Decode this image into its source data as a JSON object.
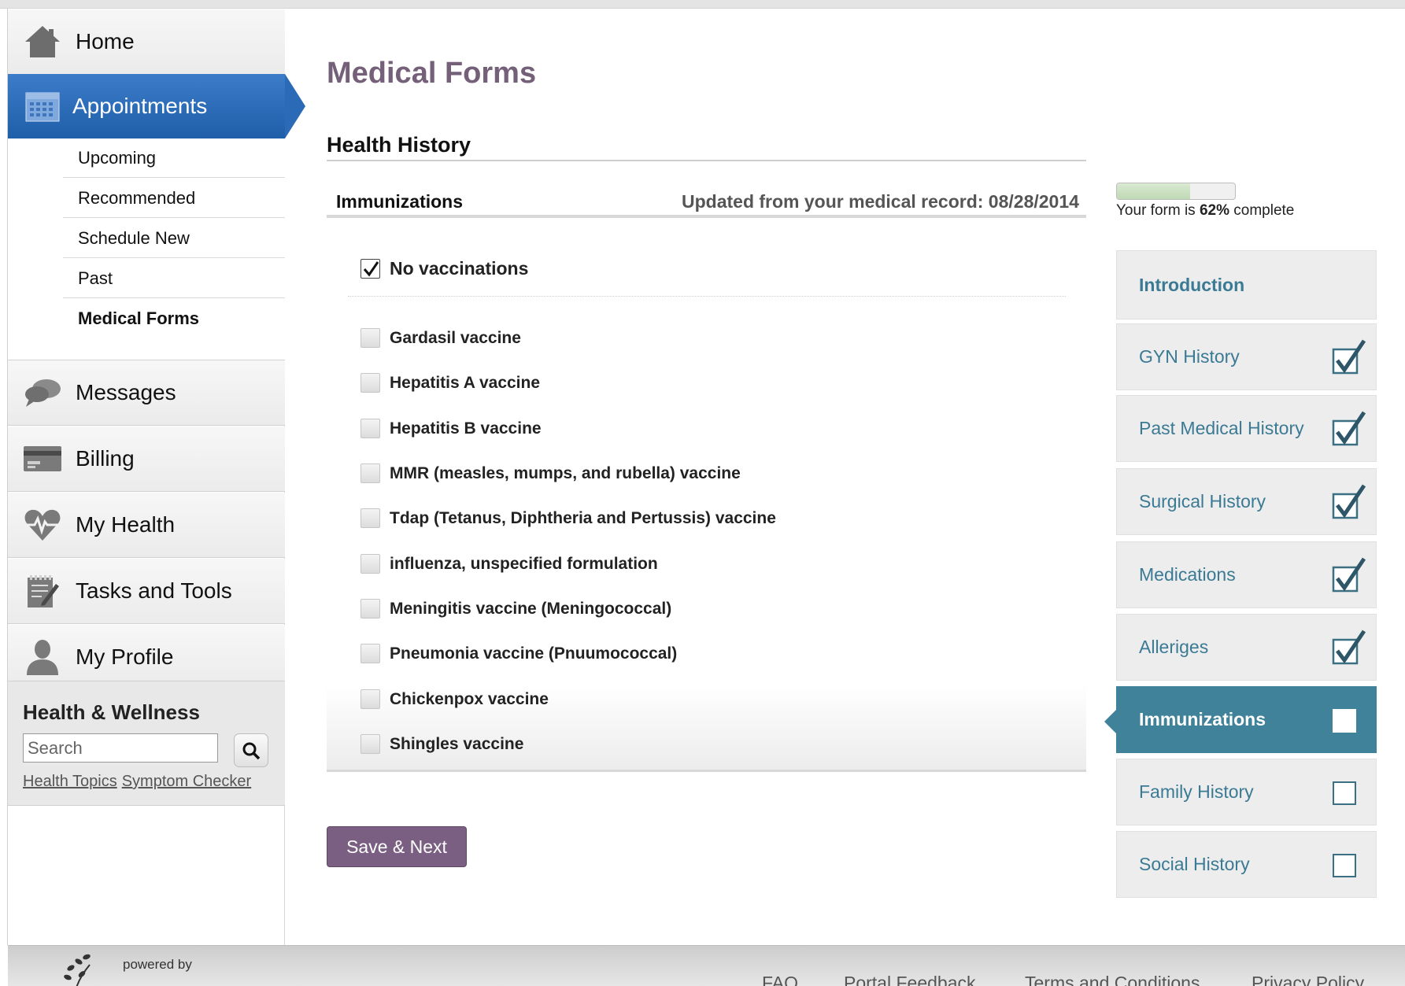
{
  "sidebar": {
    "nav": [
      {
        "label": "Home",
        "icon": "home-icon"
      },
      {
        "label": "Appointments",
        "icon": "calendar-icon"
      },
      {
        "label": "Messages",
        "icon": "chat-bubbles-icon"
      },
      {
        "label": "Billing",
        "icon": "credit-card-icon"
      },
      {
        "label": "My Health",
        "icon": "heart-pulse-icon"
      },
      {
        "label": "Tasks and Tools",
        "icon": "notepad-pencil-icon"
      },
      {
        "label": "My Profile",
        "icon": "person-icon"
      }
    ],
    "subnav": [
      {
        "label": "Upcoming"
      },
      {
        "label": "Recommended"
      },
      {
        "label": "Schedule New"
      },
      {
        "label": "Past"
      },
      {
        "label": "Medical Forms"
      }
    ],
    "health_wellness": {
      "title": "Health & Wellness",
      "search_placeholder": "Search",
      "links": [
        "Health Topics",
        "Symptom Checker"
      ]
    }
  },
  "main": {
    "title": "Medical Forms",
    "section_title": "Health History",
    "subsection_title": "Immunizations",
    "updated_text": "Updated from your medical record: 08/28/2014",
    "no_vaccinations": {
      "label": "No vaccinations",
      "checked": true
    },
    "vaccines": [
      {
        "label": "Gardasil vaccine",
        "checked": false
      },
      {
        "label": "Hepatitis A vaccine",
        "checked": false
      },
      {
        "label": "Hepatitis B vaccine",
        "checked": false
      },
      {
        "label": "MMR (measles, mumps, and rubella) vaccine",
        "checked": false
      },
      {
        "label": "Tdap (Tetanus, Diphtheria and Pertussis) vaccine",
        "checked": false
      },
      {
        "label": "influenza, unspecified formulation",
        "checked": false
      },
      {
        "label": "Meningitis vaccine (Meningococcal)",
        "checked": false
      },
      {
        "label": "Pneumonia vaccine (Pnuumococcal)",
        "checked": false
      },
      {
        "label": "Chickenpox vaccine",
        "checked": false
      },
      {
        "label": "Shingles vaccine",
        "checked": false
      }
    ],
    "save_button": "Save & Next"
  },
  "progress": {
    "percent": 62,
    "prefix": "Your form is ",
    "percent_text": "62%",
    "suffix": " complete"
  },
  "steps": [
    {
      "label": "Introduction",
      "state": "none"
    },
    {
      "label": "GYN History",
      "state": "done"
    },
    {
      "label": "Past Medical History",
      "state": "done"
    },
    {
      "label": "Surgical History",
      "state": "done"
    },
    {
      "label": "Medications",
      "state": "done"
    },
    {
      "label": "Alleriges",
      "state": "done"
    },
    {
      "label": "Immunizations",
      "state": "current"
    },
    {
      "label": "Family History",
      "state": "todo"
    },
    {
      "label": "Social History",
      "state": "todo"
    }
  ],
  "footer": {
    "powered_by": "powered by",
    "links": [
      "FAQ",
      "Portal Feedback",
      "Terms and Conditions",
      "Privacy Policy"
    ]
  },
  "colors": {
    "accent_blue": "#2a6ab6",
    "title_purple": "#75607a",
    "step_teal": "#3f8299",
    "step_text": "#3b7a94",
    "button_purple": "#7a5f82"
  }
}
